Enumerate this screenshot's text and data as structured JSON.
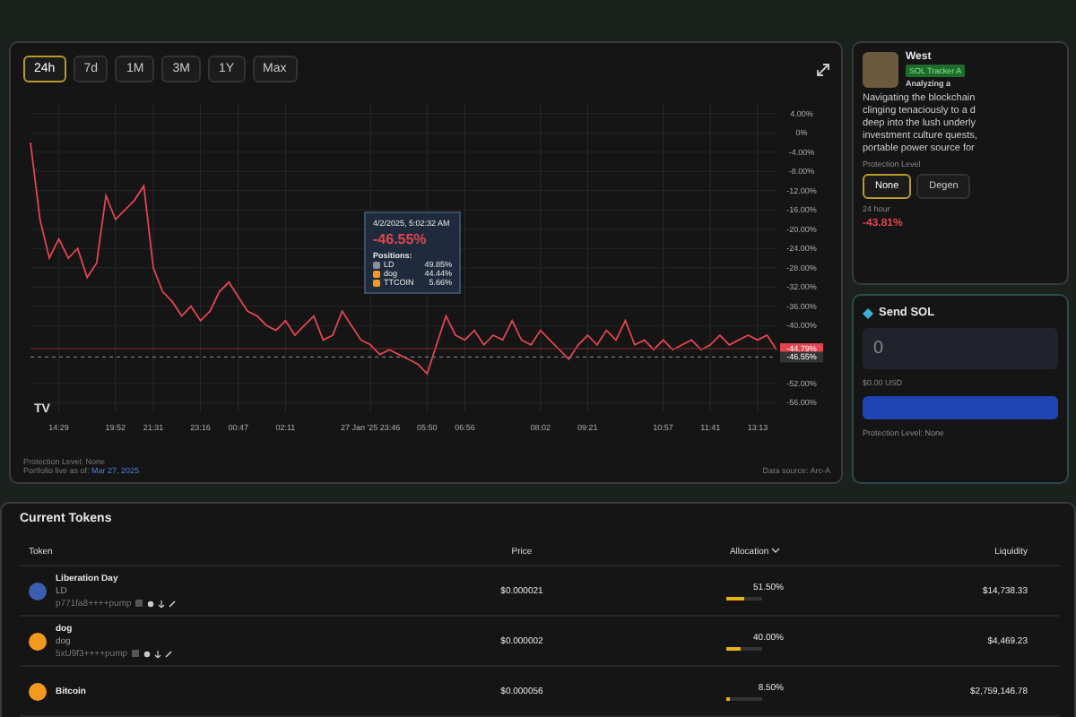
{
  "chart_panel": {
    "ranges": [
      {
        "label": "24h",
        "selected": true
      },
      {
        "label": "7d",
        "selected": false
      },
      {
        "label": "1M",
        "selected": false
      },
      {
        "label": "3M",
        "selected": false
      },
      {
        "label": "1Y",
        "selected": false
      },
      {
        "label": "Max",
        "selected": false
      }
    ],
    "chart_data": {
      "type": "line",
      "ylim": [
        -58,
        6
      ],
      "yticks": [
        {
          "value": 4,
          "label": "4.00%"
        },
        {
          "value": 0,
          "label": "0%"
        },
        {
          "value": -4,
          "label": "-4.00%"
        },
        {
          "value": -8,
          "label": "-8.00%"
        },
        {
          "value": -12,
          "label": "-12.00%"
        },
        {
          "value": -16,
          "label": "-16.00%"
        },
        {
          "value": -20,
          "label": "-20.00%"
        },
        {
          "value": -24,
          "label": "-24.00%"
        },
        {
          "value": -28,
          "label": "-28.00%"
        },
        {
          "value": -32,
          "label": "-32.00%"
        },
        {
          "value": -36,
          "label": "-36.00%"
        },
        {
          "value": -40,
          "label": "-40.00%"
        },
        {
          "value": -52,
          "label": "-52.00%"
        },
        {
          "value": -56,
          "label": "-56.00%"
        }
      ],
      "categories": [
        null,
        null,
        null,
        "14:29",
        null,
        null,
        null,
        null,
        null,
        "19:52",
        null,
        null,
        null,
        "21:31",
        null,
        null,
        null,
        null,
        "23:16",
        null,
        null,
        null,
        "00:47",
        null,
        null,
        null,
        null,
        "02:11",
        null,
        null,
        null,
        null,
        null,
        null,
        null,
        null,
        "27 Jan '25  23:46",
        null,
        null,
        null,
        null,
        null,
        "05:50",
        null,
        null,
        null,
        "06:56",
        null,
        null,
        null,
        null,
        null,
        null,
        null,
        "08:02",
        null,
        null,
        null,
        null,
        "09:21",
        null,
        null,
        null,
        null,
        null,
        null,
        null,
        "10:57",
        null,
        null,
        null,
        null,
        "11:41",
        null,
        null,
        null,
        null,
        "13:13",
        null,
        null
      ],
      "grid": true,
      "series": [
        {
          "color": "#e0454f",
          "values": [
            -2,
            -18,
            -26,
            -22,
            -26,
            -24,
            -30,
            -27,
            -13,
            -18,
            -16,
            -14,
            -11,
            -28,
            -33,
            -35,
            -38,
            -36,
            -39,
            -37,
            -33,
            -31,
            -34,
            -37,
            -38,
            -40,
            -41,
            -39,
            -42,
            -40,
            -38,
            -43,
            -42,
            -37,
            -40,
            -43,
            -44,
            -46,
            -45,
            -46,
            -47,
            -48,
            -50,
            -44,
            -38,
            -42,
            -43,
            -41,
            -44,
            -42,
            -43,
            -39,
            -43,
            -44,
            -41,
            -43,
            -45,
            -47,
            -44,
            -42,
            -44,
            -41,
            -43,
            -39,
            -44,
            -43,
            -45,
            -43,
            -45,
            -44,
            -43,
            -45,
            -44,
            -42,
            -44,
            -43,
            -42,
            -43,
            -42,
            -45
          ]
        }
      ],
      "ref_lines": [
        {
          "axis": "y",
          "value": -44.79,
          "label": "-44.79%"
        },
        {
          "axis": "y",
          "value": -46.55,
          "label": "-46.55%"
        }
      ]
    },
    "logo": "TV",
    "tooltip": {
      "date": "4/2/2025, 5:02:32 AM",
      "change": "-46.55%",
      "heading": "Positions:",
      "positions": [
        {
          "symbol": "LD",
          "share": "49.85%",
          "color": "#8a8f99"
        },
        {
          "symbol": "dog",
          "share": "44.44%",
          "color": "#f39a1e"
        },
        {
          "symbol": "TTCOIN",
          "share": "5.66%",
          "color": "#f39a1e"
        }
      ]
    },
    "footer_protection": "Protection Level: None",
    "footer_live": "Portfolio live as of:",
    "footer_date": "Mar 27, 2025",
    "data_source": "Data source: Arc-A"
  },
  "agent": {
    "name": "West",
    "tag": "SOL Tracker A",
    "status": "Analyzing a",
    "description": [
      "Navigating the blockchain",
      "clinging tenaciously to a d",
      "deep into the lush underly",
      "investment culture quests,",
      "portable power source for"
    ],
    "protection_label": "Protection Level",
    "levels": [
      {
        "label": "None",
        "selected": true
      },
      {
        "label": "Degen",
        "selected": false
      }
    ],
    "period": "24 hour",
    "change": "-43.81%"
  },
  "send": {
    "title": "Send SOL",
    "amount": "0",
    "usd": "$0.00 USD",
    "protection": "Protection Level: None"
  },
  "tokens": {
    "title": "Current Tokens",
    "columns": [
      "Token",
      "Price",
      "Allocation",
      "Liquidity"
    ],
    "rows": [
      {
        "name": "Liberation Day",
        "symbol": "LD",
        "address": "p771fa8++++pump",
        "color": "#3b5fae",
        "price": "$0.000021",
        "allocation": "51.50%",
        "level": 0.515,
        "liquidity": "$14,738.33"
      },
      {
        "name": "dog",
        "symbol": "dog",
        "address": "5xU9f3++++pump",
        "color": "#f39a1e",
        "price": "$0.000002",
        "allocation": "40.00%",
        "level": 0.4,
        "liquidity": "$4,469.23"
      },
      {
        "name": "Bitcoin",
        "price": "$0.000056",
        "allocation": "8.50%",
        "level": 0.085,
        "liquidity": "$2,759,146.78",
        "color": "#f39a1e"
      }
    ]
  }
}
